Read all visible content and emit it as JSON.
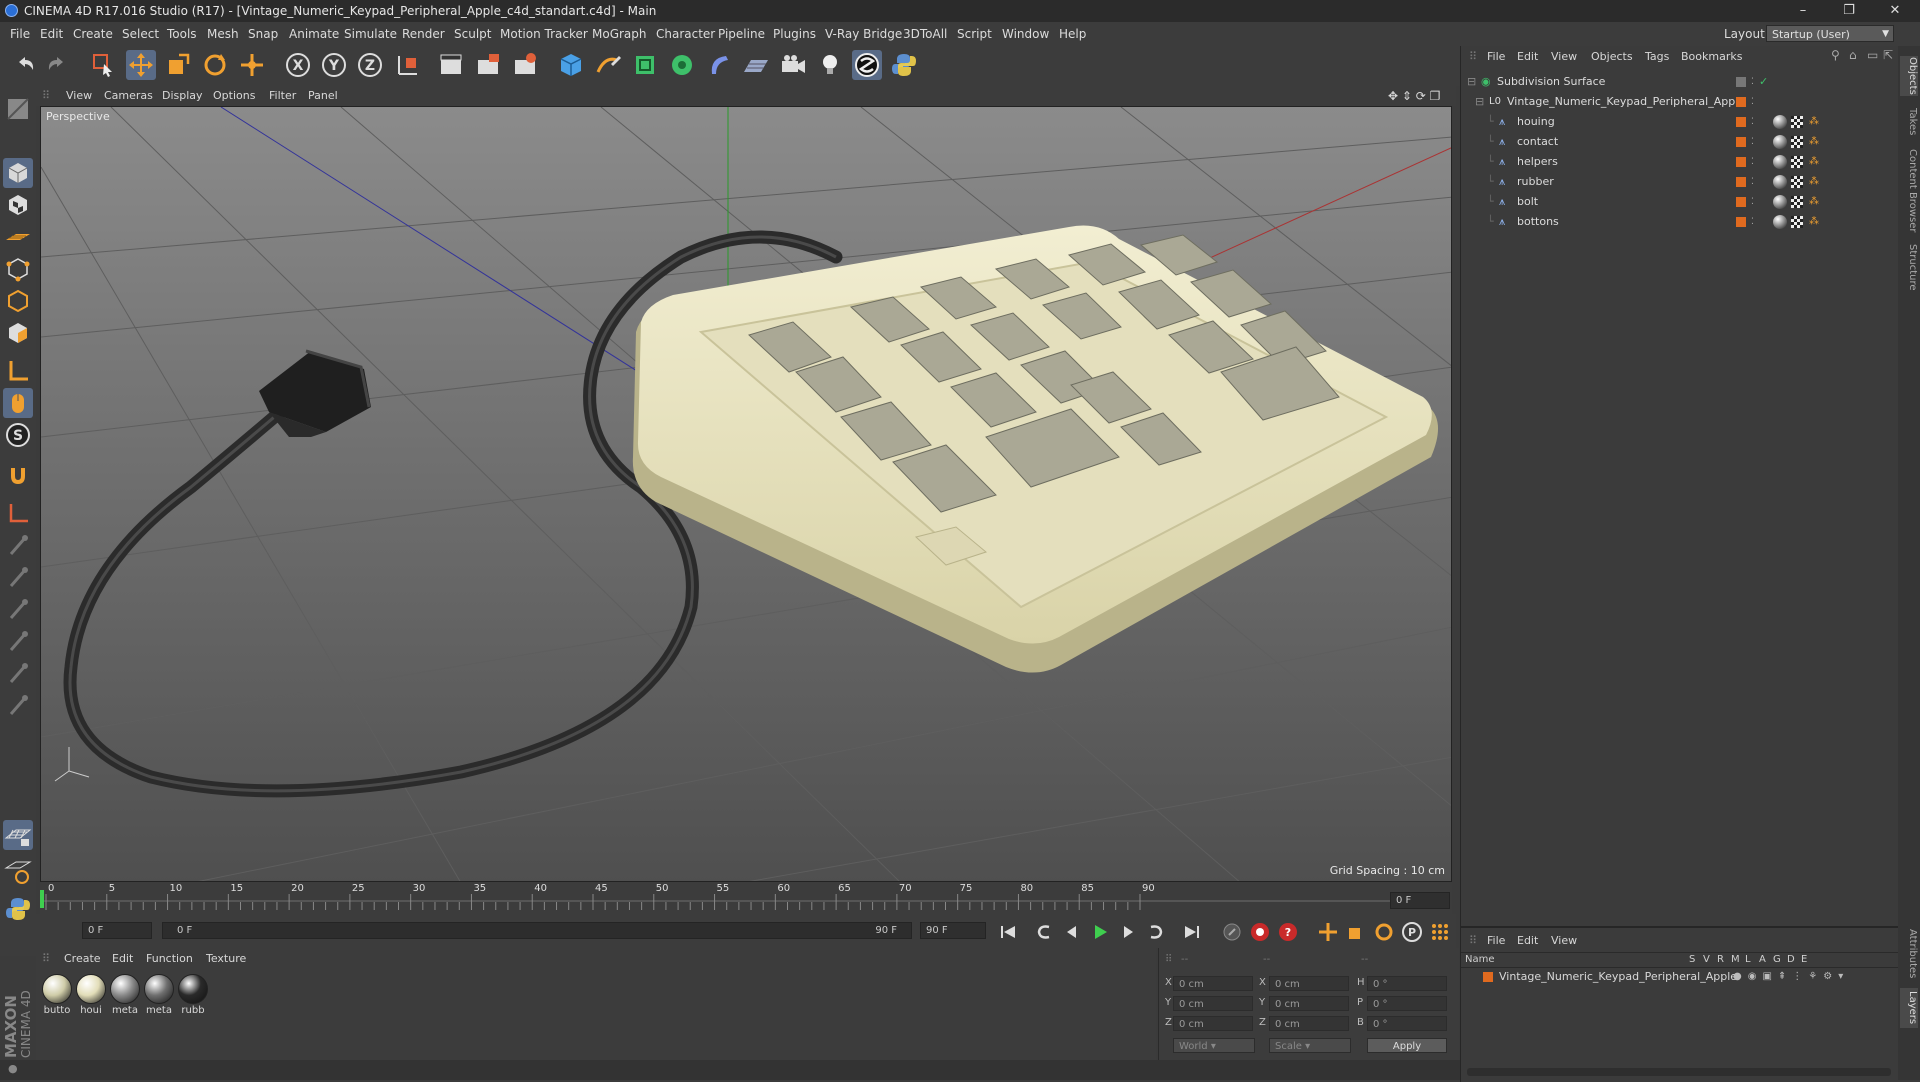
{
  "window": {
    "title": "CINEMA 4D R17.016 Studio (R17) - [Vintage_Numeric_Keypad_Peripheral_Apple_c4d_standart.c4d] - Main",
    "minimize": "–",
    "maximize": "❐",
    "close": "✕"
  },
  "menu": [
    "File",
    "Edit",
    "Create",
    "Select",
    "Tools",
    "Mesh",
    "Snap",
    "Animate",
    "Simulate",
    "Render",
    "Sculpt",
    "Motion Tracker",
    "MoGraph",
    "Character",
    "Pipeline",
    "Plugins",
    "V-Ray Bridge",
    "3DToAll",
    "Script",
    "Window",
    "Help"
  ],
  "layout": {
    "label": "Layout:",
    "value": "Startup (User)"
  },
  "viewport": {
    "menu": [
      "View",
      "Cameras",
      "Display",
      "Options",
      "Filter",
      "Panel"
    ],
    "label": "Perspective",
    "grid_spacing": "Grid Spacing : 10 cm"
  },
  "timeline": {
    "ticks": [
      "0",
      "5",
      "10",
      "15",
      "20",
      "25",
      "30",
      "35",
      "40",
      "45",
      "50",
      "55",
      "60",
      "65",
      "70",
      "75",
      "80",
      "85",
      "90"
    ],
    "current_frame": "0 F",
    "start_field": "0 F",
    "range_start": "0 F",
    "range_end": "90 F",
    "end_field": "90 F"
  },
  "materials": {
    "menu": [
      "Create",
      "Edit",
      "Function",
      "Texture"
    ],
    "items": [
      {
        "label": "butto",
        "color": "#cfcca8"
      },
      {
        "label": "houi",
        "color": "#e2ddb8"
      },
      {
        "label": "meta",
        "color": "#8a8a8a"
      },
      {
        "label": "meta",
        "color": "#6f6f6f"
      },
      {
        "label": "rubb",
        "color": "#2a2a2a"
      }
    ]
  },
  "coords": {
    "header": [
      "--",
      "--",
      "--"
    ],
    "rows": [
      {
        "axis": "X",
        "pos": "0 cm",
        "axis2": "X",
        "size": "0 cm",
        "axis3": "H",
        "rot": "0 °"
      },
      {
        "axis": "Y",
        "pos": "0 cm",
        "axis2": "Y",
        "size": "0 cm",
        "axis3": "P",
        "rot": "0 °"
      },
      {
        "axis": "Z",
        "pos": "0 cm",
        "axis2": "Z",
        "size": "0 cm",
        "axis3": "B",
        "rot": "0 °"
      }
    ],
    "mode": "World",
    "scale": "Scale",
    "apply": "Apply"
  },
  "objects": {
    "menu": [
      "File",
      "Edit",
      "View",
      "Objects",
      "Tags",
      "Bookmarks"
    ],
    "root": "Subdivision Surface",
    "group": "Vintage_Numeric_Keypad_Peripheral_Apple",
    "children": [
      "houing",
      "contact",
      "helpers",
      "rubber",
      "bolt",
      "bottons"
    ]
  },
  "layers": {
    "menu": [
      "File",
      "Edit",
      "View"
    ],
    "columns": [
      "Name",
      "S",
      "V",
      "R",
      "M",
      "L",
      "A",
      "G",
      "D",
      "E"
    ],
    "item": "Vintage_Numeric_Keypad_Peripheral_Apple"
  },
  "right_tabs": [
    "Objects",
    "Takes",
    "Content Browser",
    "Structure",
    "Attributes",
    "Layers"
  ],
  "brand": "MAXON CINEMA 4D",
  "colors": {
    "accent": "#f0a030",
    "active": "#596b87",
    "layer": "#e06a1f"
  }
}
